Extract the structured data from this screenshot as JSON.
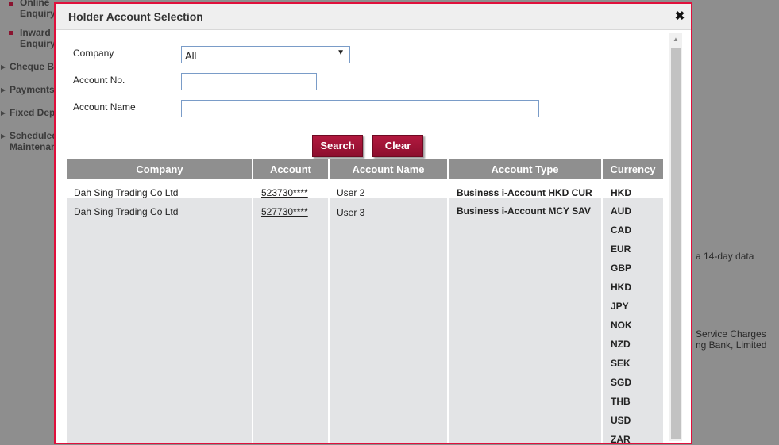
{
  "background": {
    "nav": {
      "online_enquiry": "Online\nEnquiry",
      "inward_enquiry": "Inward\nEnquiry",
      "cheque": "Cheque B",
      "payments": "Payments",
      "fixed_deposit": "Fixed Dep",
      "scheduled": "Scheduled\nMaintenan"
    },
    "note_1": "a 14-day data",
    "note_2": "Service Charges\nng Bank, Limited"
  },
  "modal": {
    "title": "Holder Account Selection",
    "close": "✖"
  },
  "form": {
    "company_label": "Company",
    "company_value": "All",
    "account_no_label": "Account No.",
    "account_no_value": "",
    "account_name_label": "Account Name",
    "account_name_value": "",
    "search_label": "Search",
    "clear_label": "Clear"
  },
  "table": {
    "headers": [
      "Company",
      "Account",
      "Account Name",
      "Account Type",
      "Currency"
    ],
    "rows": [
      {
        "company": "Dah Sing Trading Co Ltd",
        "account": "523730****",
        "account_name": "User 2",
        "account_type": "Business i-Account HKD CUR",
        "currencies": [
          "HKD"
        ]
      },
      {
        "company": "Dah Sing Trading Co Ltd",
        "account": "527730****",
        "account_name": "User 3",
        "account_type": "Business i-Account MCY SAV",
        "currencies": [
          "AUD",
          "CAD",
          "EUR",
          "GBP",
          "HKD",
          "JPY",
          "NOK",
          "NZD",
          "SEK",
          "SGD",
          "THB",
          "USD",
          "ZAR"
        ]
      }
    ]
  },
  "colors": {
    "accent": "#e0103c",
    "button": "#9c1236",
    "header_gray": "#8f8f8f"
  }
}
